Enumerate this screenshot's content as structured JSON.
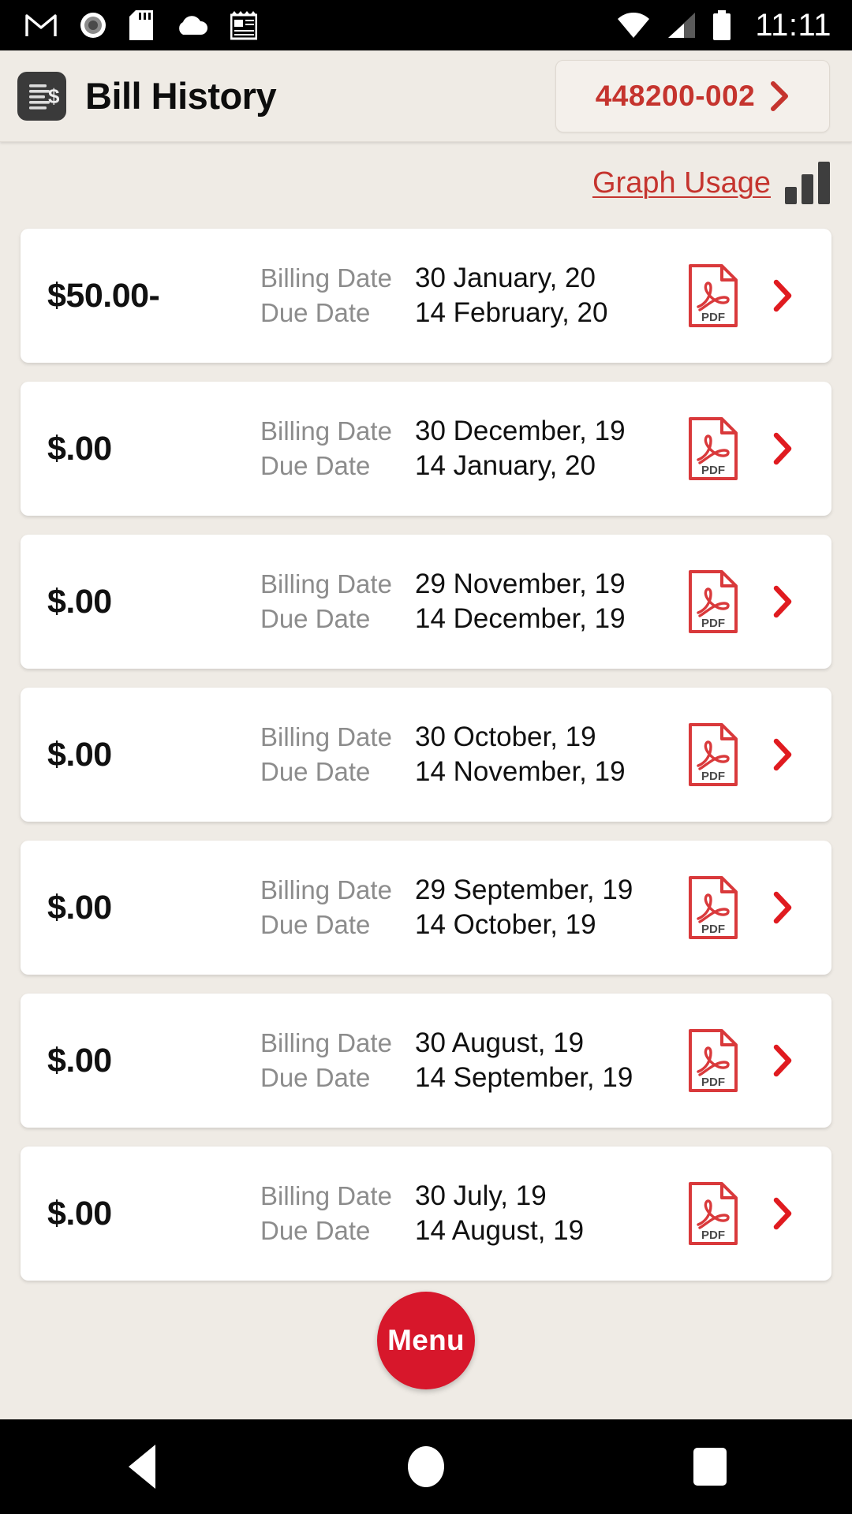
{
  "status_bar": {
    "time": "11:11",
    "left_icons": [
      "gmail-icon",
      "record-icon",
      "sd-card-icon",
      "cloud-icon",
      "notepad-icon"
    ],
    "right_icons": [
      "wifi-icon",
      "cellular-signal-icon",
      "battery-icon"
    ]
  },
  "header": {
    "title": "Bill History",
    "icon": "bill-document-icon",
    "account_button": {
      "number": "448200-002",
      "chevron": "chevron-right-icon"
    }
  },
  "toolbar": {
    "graph_usage_label": "Graph Usage",
    "graph_icon": "bar-chart-icon"
  },
  "labels": {
    "billing_date": "Billing Date",
    "due_date": "Due Date",
    "pdf_badge": "PDF"
  },
  "colors": {
    "accent_red": "#C5342E",
    "fab_red": "#D7172B",
    "page_bg": "#EFEBE5",
    "card_bg": "#FFFFFF",
    "muted_text": "#8C8C8C"
  },
  "bills": [
    {
      "amount": "$50.00-",
      "billing_date": "30 January, 20",
      "due_date": "14 February, 20"
    },
    {
      "amount": "$.00",
      "billing_date": "30 December, 19",
      "due_date": "14 January, 20"
    },
    {
      "amount": "$.00",
      "billing_date": "29 November, 19",
      "due_date": "14 December, 19"
    },
    {
      "amount": "$.00",
      "billing_date": "30 October, 19",
      "due_date": "14 November, 19"
    },
    {
      "amount": "$.00",
      "billing_date": "29 September, 19",
      "due_date": "14 October, 19"
    },
    {
      "amount": "$.00",
      "billing_date": "30 August, 19",
      "due_date": "14 September, 19"
    },
    {
      "amount": "$.00",
      "billing_date": "30 July, 19",
      "due_date": "14 August, 19"
    }
  ],
  "fab": {
    "label": "Menu"
  },
  "nav_bar": {
    "back": "back-triangle-icon",
    "home": "home-circle-icon",
    "recents": "recents-square-icon"
  }
}
